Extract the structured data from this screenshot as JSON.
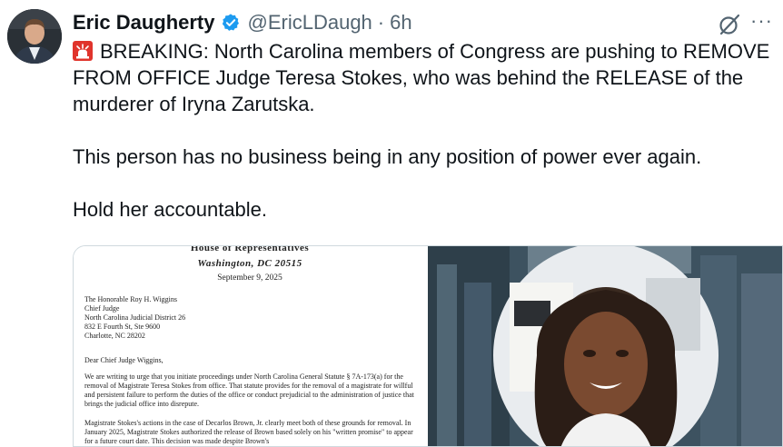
{
  "tweet": {
    "author_name": "Eric Daugherty",
    "handle": "@EricLDaugh",
    "separator": "·",
    "time": "6h",
    "more_label": "···",
    "icons": {
      "verified": "verified-badge-icon",
      "grok": "grok-icon",
      "siren": "rotating-light-emoji",
      "more": "more-options-icon"
    },
    "colors": {
      "verified": "#1d9bf0",
      "secondary_text": "#536471",
      "siren": "#e0342c"
    },
    "text": {
      "paragraph_1": "BREAKING: North Carolina members of Congress are pushing to REMOVE FROM OFFICE Judge Teresa Stokes, who was behind the RELEASE of the murderer of Iryna Zarutska.",
      "paragraph_2": "This person has no business being in any position of power ever again.",
      "paragraph_3": "Hold her accountable."
    }
  },
  "letter": {
    "letterhead_1": "House of Representatives",
    "letterhead_2": "Washington, DC 20515",
    "date": "September 9, 2025",
    "address_lines": [
      "The Honorable Roy H. Wiggins",
      "Chief Judge",
      "North Carolina Judicial District 26",
      "832 E Fourth St, Ste 9600",
      "Charlotte, NC 28202"
    ],
    "salutation": "Dear Chief Judge Wiggins,",
    "paragraph_1": "We are writing to urge that you initiate proceedings under North Carolina General Statute § 7A-173(a) for the removal of Magistrate Teresa Stokes from office. That statute provides for the removal of a magistrate for willful and persistent failure to perform the duties of the office or conduct prejudicial to the administration of justice that brings the judicial office into disrepute.",
    "paragraph_2": "Magistrate Stokes's actions in the case of Decarlos Brown, Jr. clearly meet both of these grounds for removal. In January 2025, Magistrate Stokes authorized the release of Brown based solely on his \"written promise\" to appear for a future court date. This decision was made despite Brown's"
  }
}
